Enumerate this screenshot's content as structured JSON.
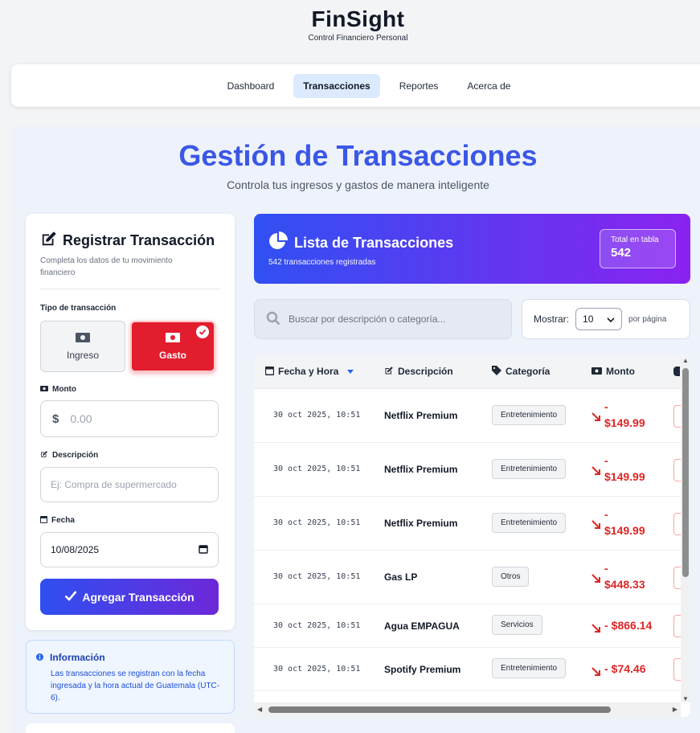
{
  "brand": {
    "title": "FinSight",
    "subtitle": "Control Financiero Personal"
  },
  "nav": [
    {
      "label": "Dashboard",
      "active": false
    },
    {
      "label": "Transacciones",
      "active": true
    },
    {
      "label": "Reportes",
      "active": false
    },
    {
      "label": "Acerca de",
      "active": false
    }
  ],
  "page": {
    "title": "Gestión de Transacciones",
    "subtitle": "Controla tus ingresos y gastos de manera inteligente"
  },
  "form": {
    "title": "Registrar Transacción",
    "description": "Completa los datos de tu movimiento financiero",
    "type_label": "Tipo de transacción",
    "type_ingreso": "Ingreso",
    "type_gasto": "Gasto",
    "selected_type": "Gasto",
    "amount_label": "Monto",
    "amount_currency": "$",
    "amount_placeholder": "0.00",
    "desc_label": "Descripción",
    "desc_placeholder": "Ej: Compra de supermercado",
    "date_label": "Fecha",
    "date_value": "10/08/2025",
    "submit_label": "Agregar Transacción"
  },
  "info": {
    "title": "Información",
    "text": "Las transacciones se registran con la fecha ingresada y la hora actual de Guatemala (UTC-6)."
  },
  "list": {
    "title": "Lista de Transacciones",
    "subtitle": "542 transacciones registradas",
    "total_label": "Total en tabla",
    "total_value": "542"
  },
  "search": {
    "placeholder": "Buscar por descripción o categoría..."
  },
  "pagination": {
    "show_label": "Mostrar:",
    "page_size": "10",
    "per_page_label": "por página"
  },
  "table": {
    "columns": {
      "date": "Fecha y Hora",
      "description": "Descripción",
      "category": "Categoría",
      "amount": "Monto"
    },
    "rows": [
      {
        "date": "30 oct 2025, 10:51",
        "description": "Netflix Premium",
        "category": "Entretenimiento",
        "amount_sign": "-",
        "amount_value": "$149.99"
      },
      {
        "date": "30 oct 2025, 10:51",
        "description": "Netflix Premium",
        "category": "Entretenimiento",
        "amount_sign": "-",
        "amount_value": "$149.99"
      },
      {
        "date": "30 oct 2025, 10:51",
        "description": "Netflix Premium",
        "category": "Entretenimiento",
        "amount_sign": "-",
        "amount_value": "$149.99"
      },
      {
        "date": "30 oct 2025, 10:51",
        "description": "Gas LP",
        "category": "Otros",
        "amount_sign": "-",
        "amount_value": "$448.33"
      },
      {
        "date": "30 oct 2025, 10:51",
        "description": "Agua EMPAGUA",
        "category": "Servicios",
        "amount_sign": "-",
        "amount_value": "$866.14"
      },
      {
        "date": "30 oct 2025, 10:51",
        "description": "Spotify Premium",
        "category": "Entretenimiento",
        "amount_sign": "-",
        "amount_value": "$74.46"
      }
    ]
  },
  "colors": {
    "accent": "#3b57e6",
    "expense": "#dc2626",
    "gradient_start": "#3050f2",
    "gradient_end": "#8a22f0"
  }
}
